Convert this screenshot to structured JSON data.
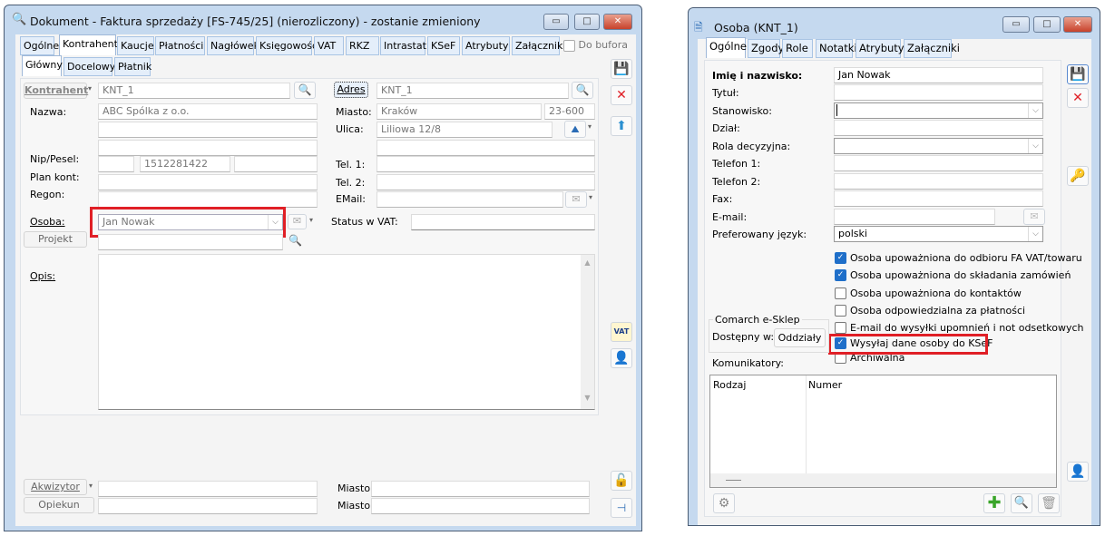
{
  "doc": {
    "title": "Dokument - Faktura sprzedaży [FS-745/25] (nierozliczony) - zostanie zmieniony",
    "tabs": [
      "Ogólne",
      "Kontrahent",
      "Kaucje",
      "Płatności",
      "Nagłówek",
      "Księgowość",
      "VAT",
      "RKZ",
      "Intrastat",
      "KSeF",
      "Atrybuty",
      "Załączniki"
    ],
    "active_tab": "Kontrahent",
    "do_bufora": "Do bufora",
    "subtabs": [
      "Główny",
      "Docelowy",
      "Płatnik"
    ],
    "active_subtab": "Główny",
    "kontrahent_btn": "Kontrahent",
    "kontrahent_val": "KNT_1",
    "adres_btn": "Adres",
    "adres_val": "KNT_1",
    "nazwa_lbl": "Nazwa:",
    "nazwa_val": "ABC Spólka z o.o.",
    "miasto_lbl": "Miasto:",
    "miasto_val": "Kraków",
    "kod": "23-600",
    "ulica_lbl": "Ulica:",
    "ulica_val": "Liliowa 12/8",
    "nip_lbl": "Nip/Pesel:",
    "nip_val": "1512281422",
    "plan_lbl": "Plan kont:",
    "regon_lbl": "Regon:",
    "tel1_lbl": "Tel. 1:",
    "tel2_lbl": "Tel. 2:",
    "email_lbl": "EMail:",
    "osoba_lbl": "Osoba:",
    "osoba_val": "Jan Nowak",
    "status_vat_lbl": "Status w VAT:",
    "projekt_btn": "Projekt",
    "opis_lbl": "Opis:",
    "akwizytor_btn": "Akwizytor",
    "opiekun_btn": "Opiekun",
    "miasto2_lbl": "Miasto:"
  },
  "osoba": {
    "title": "Osoba  (KNT_1)",
    "tabs": [
      "Ogólne",
      "Zgody",
      "Role",
      "Notatki",
      "Atrybuty",
      "Załączniki"
    ],
    "active_tab": "Ogólne",
    "fields": [
      {
        "label": "Imię i nazwisko:",
        "value": "Jan Nowak"
      },
      {
        "label": "Tytuł:",
        "value": ""
      },
      {
        "label": "Stanowisko:",
        "value": ""
      },
      {
        "label": "Dział:",
        "value": ""
      },
      {
        "label": "Rola decyzyjna:",
        "value": ""
      },
      {
        "label": "Telefon 1:",
        "value": ""
      },
      {
        "label": "Telefon 2:",
        "value": ""
      },
      {
        "label": "Fax:",
        "value": ""
      },
      {
        "label": "E-mail:",
        "value": ""
      },
      {
        "label": "Preferowany język:",
        "value": "polski"
      }
    ],
    "checks": [
      {
        "label": "Osoba upoważniona do odbioru FA VAT/towaru",
        "checked": true
      },
      {
        "label": "Osoba upoważniona do składania zamówień",
        "checked": true
      },
      {
        "label": "Osoba upoważniona do kontaktów",
        "checked": false
      },
      {
        "label": "Osoba odpowiedzialna za płatności",
        "checked": false
      },
      {
        "label": "E-mail do wysyłki upomnień i not odsetkowych",
        "checked": false
      },
      {
        "label": "Wysyłaj dane osoby do KSeF",
        "checked": true
      },
      {
        "label": "Archiwalna",
        "checked": false
      }
    ],
    "esklep_group": "Comarch e-Sklep",
    "dostepny_lbl": "Dostępny w:",
    "oddzialy_btn": "Oddziały",
    "komunikatory_lbl": "Komunikatory:",
    "columns": [
      "Rodzaj",
      "Numer"
    ]
  },
  "colors": {
    "highlight": "#e01f26",
    "check": "#1f6fc9",
    "tab_bg": "#e4eefa",
    "window_frame": "#c5d9ef"
  }
}
